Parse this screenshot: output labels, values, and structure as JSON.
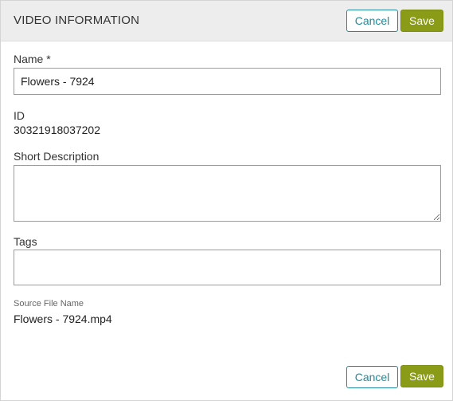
{
  "header": {
    "title": "VIDEO INFORMATION",
    "cancel_label": "Cancel",
    "save_label": "Save"
  },
  "form": {
    "name_label": "Name *",
    "name_value": "Flowers - 7924",
    "id_label": "ID",
    "id_value": "30321918037202",
    "short_description_label": "Short Description",
    "short_description_value": "",
    "tags_label": "Tags",
    "tags_value": "",
    "source_file_label": "Source File Name",
    "source_file_value": "Flowers - 7924.mp4"
  },
  "footer": {
    "cancel_label": "Cancel",
    "save_label": "Save"
  },
  "colors": {
    "accent_teal": "#1f8b9c",
    "save_green": "#8a9b17",
    "header_bg": "#ededed"
  }
}
